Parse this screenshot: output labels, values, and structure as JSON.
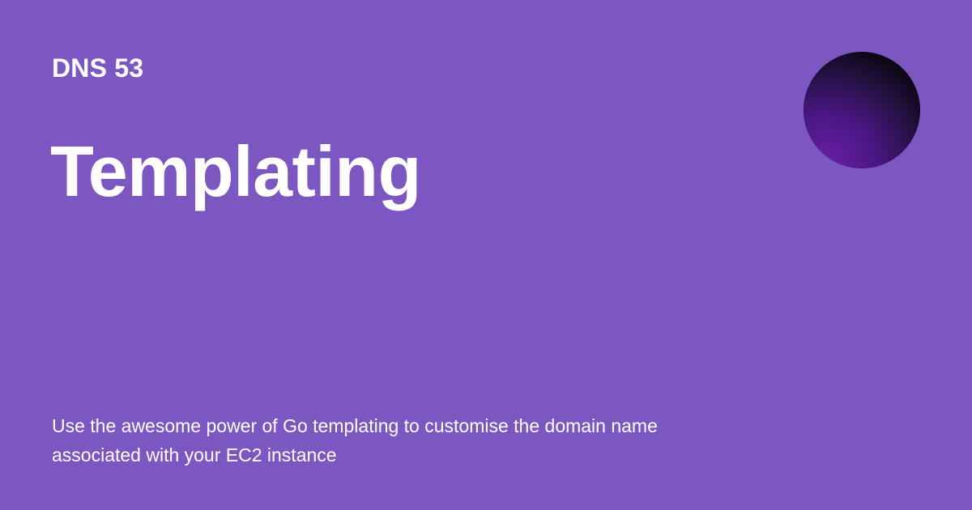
{
  "site": {
    "name": "DNS 53"
  },
  "page": {
    "title": "Templating",
    "description": "Use the awesome power of Go templating to customise the domain name associated with your EC2 instance"
  },
  "logo": {
    "icon": "gradient-circle-logo-icon",
    "colors": {
      "top": "#030205",
      "middle": "#231141",
      "bottom": "#6b1fa7"
    }
  },
  "colors": {
    "background": "#7c57c1",
    "text": "#ffffff"
  }
}
